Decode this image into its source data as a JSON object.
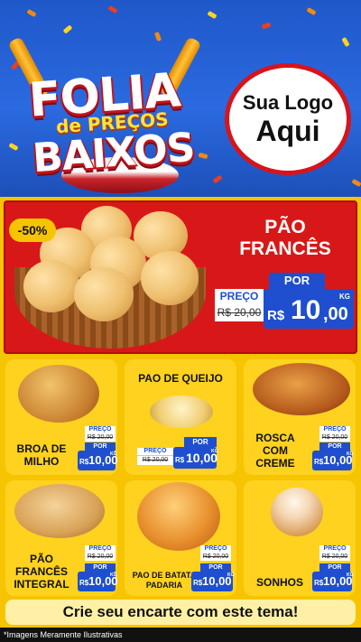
{
  "header": {
    "title_line1": "FOLIA",
    "title_line2": "de PREÇOS",
    "title_line3": "BAIXOS",
    "logo_line1": "Sua Logo",
    "logo_line2": "Aqui"
  },
  "featured": {
    "discount": "-50%",
    "name": "PÃO FRANCÊS",
    "preco_label": "PREÇO",
    "por_label": "POR",
    "old_price": "R$ 20,00",
    "currency": "R$",
    "price_int": "10",
    "price_dec": ",00",
    "unit": "KG"
  },
  "products": [
    {
      "name": "BROA DE MILHO",
      "old_price": "R$ 20,00",
      "currency": "R$",
      "price": "10,00",
      "preco_label": "PREÇO",
      "por_label": "POR",
      "unit": "KG"
    },
    {
      "name": "PAO DE QUEIJO",
      "old_price": "R$ 20,00",
      "currency": "R$",
      "price": "10,00",
      "preco_label": "PREÇO",
      "por_label": "POR",
      "unit": "KG"
    },
    {
      "name": "ROSCA COM CREME",
      "old_price": "R$ 20,00",
      "currency": "R$",
      "price": "10,00",
      "preco_label": "PREÇO",
      "por_label": "POR",
      "unit": "KG"
    },
    {
      "name": "PÃO FRANCÊS INTEGRAL",
      "old_price": "R$ 20,00",
      "currency": "R$",
      "price": "10,00",
      "preco_label": "PREÇO",
      "por_label": "POR",
      "unit": "KG"
    },
    {
      "name": "PAO DE BATATA PADARIA",
      "old_price": "R$ 20,00",
      "currency": "R$",
      "price": "10,00",
      "preco_label": "PREÇO",
      "por_label": "POR",
      "unit": "KG"
    },
    {
      "name": "SONHOS",
      "old_price": "R$ 20,00",
      "currency": "R$",
      "price": "10,00",
      "preco_label": "PREÇO",
      "por_label": "POR",
      "unit": "KG"
    }
  ],
  "cta": "Crie seu encarte com este tema!",
  "footer": "*Imagens Meramente Ilustrativas",
  "colors": {
    "header_blue": "#2b6ae0",
    "featured_red": "#d81818",
    "card_yellow": "#ffd21f",
    "price_blue": "#1f4fcf"
  }
}
